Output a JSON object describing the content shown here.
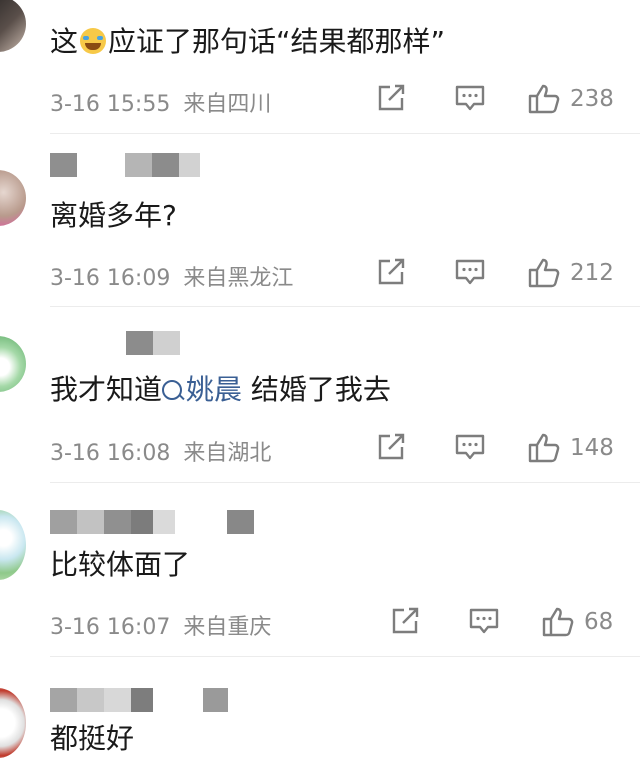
{
  "comments": [
    {
      "text_prefix": "这",
      "emoji": "laugh-cry-emoji",
      "text_suffix": "应证了那句话“结果都那样”",
      "time": "3-16 15:55",
      "location": "来自四川",
      "likes": "238"
    },
    {
      "text": "离婚多年?",
      "time": "3-16 16:09",
      "location": "来自黑龙江",
      "likes": "212"
    },
    {
      "text_prefix": "我才知道",
      "mention": "姚晨",
      "text_suffix": " 结婚了我去",
      "time": "3-16 16:08",
      "location": "来自湖北",
      "likes": "148"
    },
    {
      "text": "比较体面了",
      "time": "3-16 16:07",
      "location": "来自重庆",
      "likes": "68"
    },
    {
      "text": "都挺好"
    }
  ],
  "icons": [
    "share-icon",
    "comment-icon",
    "like-icon"
  ],
  "colors": {
    "meta": "#8a8a8a",
    "mention": "#3a5f94",
    "text": "#1a1a1a"
  }
}
